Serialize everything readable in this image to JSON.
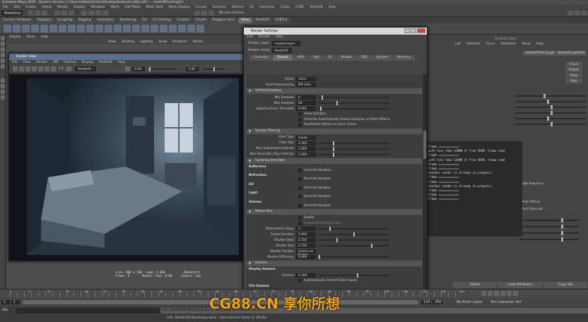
{
  "app": {
    "title": "Autodesk Maya 2016 - Student Version: C:\\Users\\Administrator\\Desktop\\bedroom_light.mb* --- redshiftPointLight1"
  },
  "menubar": [
    "File",
    "Edit",
    "Create",
    "Select",
    "Modify",
    "Display",
    "Windows",
    "Mesh",
    "Edit Mesh",
    "Mesh Tools",
    "Mesh Display",
    "Curves",
    "Surfaces",
    "Deform",
    "UV",
    "Generate",
    "Cache",
    "CUBE",
    "Redshift",
    "Help"
  ],
  "status": {
    "mode": "Modeling",
    "live_surface": "No Live Surface"
  },
  "shelf_tabs": [
    "Curves / Surfaces",
    "Polygons",
    "Sculpting",
    "Rigging",
    "Animation",
    "Rendering",
    "FX",
    "FX Caching",
    "Custom",
    "Arnold",
    "Polygons User",
    "XGen",
    "Redshift",
    "TURTLE"
  ],
  "shelf_active": "XGen",
  "viewport_menu": [
    "View",
    "Shading",
    "Lighting",
    "Show",
    "Renderer",
    "Panels"
  ],
  "viewport_left_menu": [
    "Display",
    "Show",
    "Help"
  ],
  "render_view": {
    "title": "Render View",
    "menu": [
      "File",
      "View",
      "Render",
      "IPR",
      "Options",
      "Display",
      "Redshift",
      "Help"
    ],
    "renderer": "Redshift",
    "exposure": "0.00",
    "gamma": "1.00",
    "ratio": "1:1",
    "info_line1": "size: 960 x 540  zoom: 1.000          (Redshift)",
    "info_line2": "Frame: 0       Render Time: 0:08     Camera: Cam"
  },
  "render_settings": {
    "title": "Render Settings",
    "menu": [
      "Edit",
      "Presets",
      "Help"
    ],
    "render_layer_label": "Render Layer",
    "render_layer_value": "masterLayer",
    "render_using_label": "Render Using",
    "render_using_value": "Redshift",
    "tabs": [
      "Common",
      "Output",
      "AOV",
      "Opt",
      "GI",
      "Photon",
      "SSS",
      "System",
      "Memory"
    ],
    "active_tab": "Output",
    "top_fields": [
      {
        "label": "Points",
        "value": "1024"
      },
      {
        "label": "Fast Preprocessing",
        "value": "IPR Only"
      }
    ],
    "unified_sampling": {
      "title": "Unified Sampling",
      "fields": [
        {
          "label": "Min Samples",
          "value": "4",
          "slider": 0.04
        },
        {
          "label": "Max Samples",
          "value": "64",
          "slider": 0.25
        },
        {
          "label": "Adaptive Error Threshold",
          "value": "0.001",
          "slider": 0.02
        }
      ],
      "checks": [
        "Show Samples",
        "Override Automatically Reduce Samples of Other Effects",
        "Randomize Pattern on Each Frame"
      ]
    },
    "filtering": {
      "title": "Sample Filtering",
      "fields": [
        {
          "label": "Filter Type",
          "value": "Gauss"
        },
        {
          "label": "Filter Size",
          "value": "2.000",
          "slider": 0.2
        },
        {
          "label": "Max Subsample Intensity",
          "value": "2.000",
          "slider": 0.2
        },
        {
          "label": "Max Secondary Ray Intensity",
          "value": "2.000",
          "slider": 0.2
        }
      ]
    },
    "overrides": {
      "title": "Sampling Overrides",
      "items": [
        "Reflection",
        "Refraction",
        "AO",
        "Light",
        "Volume"
      ],
      "override_label": "Override Samples"
    },
    "motion_blur": {
      "title": "Motion Blur",
      "checks": [
        "Enable",
        "Enable Deformation Blur"
      ],
      "fields": [
        {
          "label": "Deformation Steps",
          "value": "3",
          "slider": 0.15
        },
        {
          "label": "Frame Duration",
          "value": "1.000",
          "slider": 0.5
        },
        {
          "label": "Shutter Start",
          "value": "0.250",
          "slider": 0.25
        },
        {
          "label": "Shutter End",
          "value": "0.750",
          "slider": 0.75
        },
        {
          "label": "Shutter Position",
          "value": "Center on Frame"
        },
        {
          "label": "Shutter Efficiency",
          "value": "0.000",
          "slider": 0.0
        }
      ]
    },
    "gamma": {
      "title": "Gamma",
      "display_label": "Display Gamma",
      "gamma_label": "Gamma",
      "gamma_value": "2.200",
      "gamma_slider": 0.55,
      "auto_label": "Automatically Convert Color Inputs",
      "file_gamma_label": "File Gamma",
      "mode_label": "Mode",
      "mode_value": "Automatic"
    }
  },
  "attribute_editor": {
    "title": "Attribute Editor",
    "menu": [
      "List",
      "Selected",
      "Focus",
      "Attributes",
      "Show",
      "Help"
    ],
    "node_tabs": [
      "redshiftPointLightShape1",
      "defaultLightSet"
    ],
    "side_buttons": [
      "Focus",
      "Presets",
      "Show",
      "Hide"
    ],
    "buttons": [
      "Select",
      "Load Attributes",
      "Copy Tab"
    ],
    "labels": [
      "Image Sequence",
      "Affects Diffuse",
      "Affects Specular"
    ]
  },
  "script_output": [
    "Frame ============",
    "with less than 128MB of free VRAM. Frame rend",
    "Frame ============",
    "with less than 128MB of free VRAM. Frame rend",
    "Frame ============",
    "Frame ============",
    "Another render is already in progress.",
    "Frame ============",
    "Frame ============",
    "Another render is already in progress.",
    "Frame ============",
    "Frame ============",
    "Frame ============"
  ],
  "timeline": {
    "frames": [
      "1",
      "5",
      "10",
      "15",
      "20",
      "25",
      "30",
      "35",
      "40",
      "45",
      "50",
      "55",
      "60",
      "65",
      "70",
      "75",
      "80",
      "85",
      "90",
      "95",
      "100",
      "105",
      "110",
      "115",
      "120"
    ],
    "start": "1",
    "end": "120",
    "range_end": "200",
    "anim_layer": "No Anim Layer",
    "char_set": "No Character Set"
  },
  "command": {
    "label": "MEL"
  },
  "help_line": "Info: [Redshift] Rendering done - total time for frame 0: 29.61s",
  "watermark": "CG88.CN 享你所想"
}
